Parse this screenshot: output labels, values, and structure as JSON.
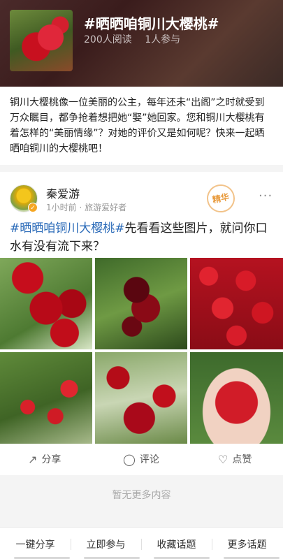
{
  "topic": {
    "title": "#晒晒咱铜川大樱桃#",
    "reads": "200人阅读",
    "participants": "1人参与",
    "intro": "铜川大樱桃像一位美丽的公主，每年还未“出阁”之时就受到万众瞩目，都争抢着想把她“娶”她回家。您和铜川大樱桃有着怎样的“美丽情缘”？对她的评价又是如何呢？快来一起晒晒咱铜川的大樱桃吧！"
  },
  "post": {
    "username": "秦爱游",
    "meta": "1小时前 · 旅游爱好者",
    "stamp": "精华",
    "more": "···",
    "tag": "#晒晒咱铜川大樱桃#",
    "text": "先看看这些图片，就问你口水有没有流下来？",
    "actions": {
      "share": "分享",
      "comment": "评论",
      "like": "点赞"
    }
  },
  "feed_end": "暂无更多内容",
  "bottom_bar": [
    "一键分享",
    "立即参与",
    "收藏话题",
    "更多话题"
  ],
  "icons": {
    "share": "share-icon",
    "comment": "comment-icon",
    "like": "heart-icon"
  },
  "colors": {
    "hashtag": "#2a6ab8",
    "stamp": "#e89a3c"
  }
}
